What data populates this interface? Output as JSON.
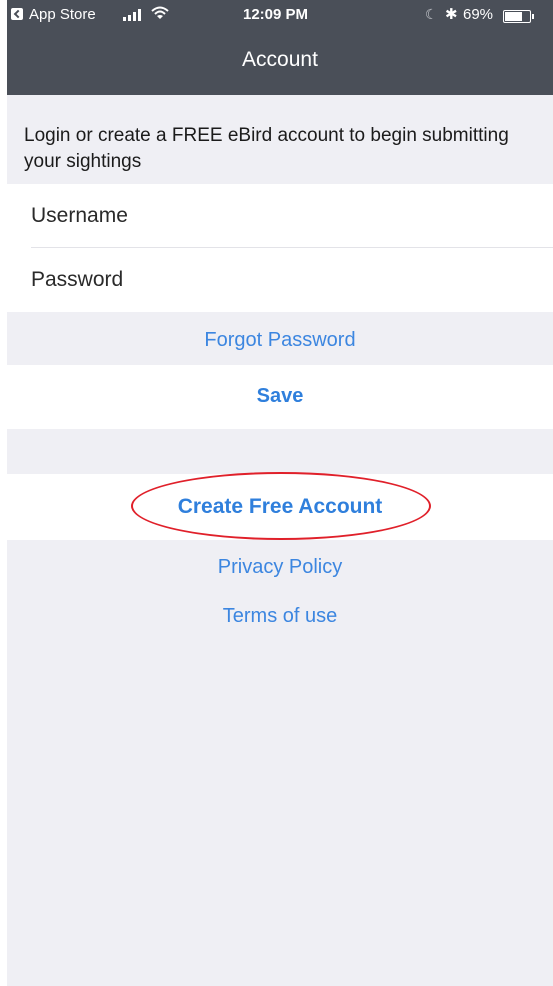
{
  "status_bar": {
    "back_app": "App Store",
    "time": "12:09 PM",
    "battery": "69%",
    "battery_level": 0.69,
    "icons": [
      "back-arrow-icon",
      "signal-icon",
      "wifi-icon",
      "moon-icon",
      "bluetooth-icon",
      "battery-icon"
    ]
  },
  "nav": {
    "title": "Account"
  },
  "intro_text": "Login or create a FREE eBird account to begin submitting your sightings",
  "form": {
    "username_placeholder": "Username",
    "password_placeholder": "Password"
  },
  "links": {
    "forgot_password": "Forgot Password",
    "save": "Save",
    "create_account": "Create Free Account",
    "privacy_policy": "Privacy Policy",
    "terms_of_use": "Terms of use"
  },
  "colors": {
    "nav_background": "#4a4f58",
    "page_background": "#efeff4",
    "link_blue": "#3c86e0",
    "highlight_red": "#e0202a"
  }
}
